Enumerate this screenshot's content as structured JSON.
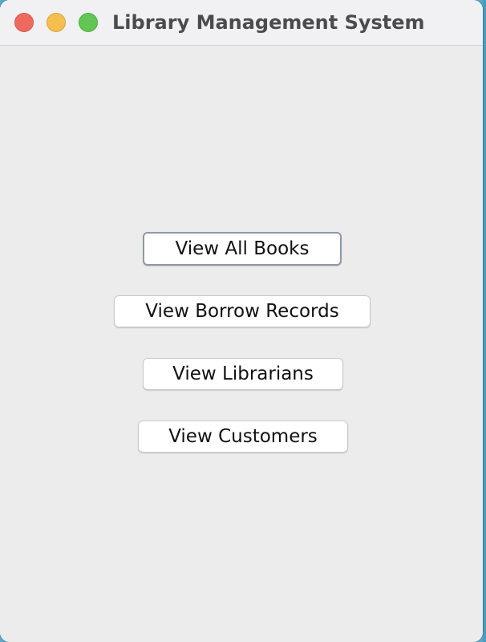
{
  "window": {
    "title": "Library Management System"
  },
  "buttons": {
    "view_all_books": "View All Books",
    "view_borrow_records": "View Borrow Records",
    "view_librarians": "View Librarians",
    "view_customers": "View Customers"
  },
  "colors": {
    "close": "#ee6a5f",
    "minimize": "#f5bf4f",
    "zoom": "#62c554",
    "window_bg": "#ececec",
    "focus_ring": "#8e99a8"
  }
}
